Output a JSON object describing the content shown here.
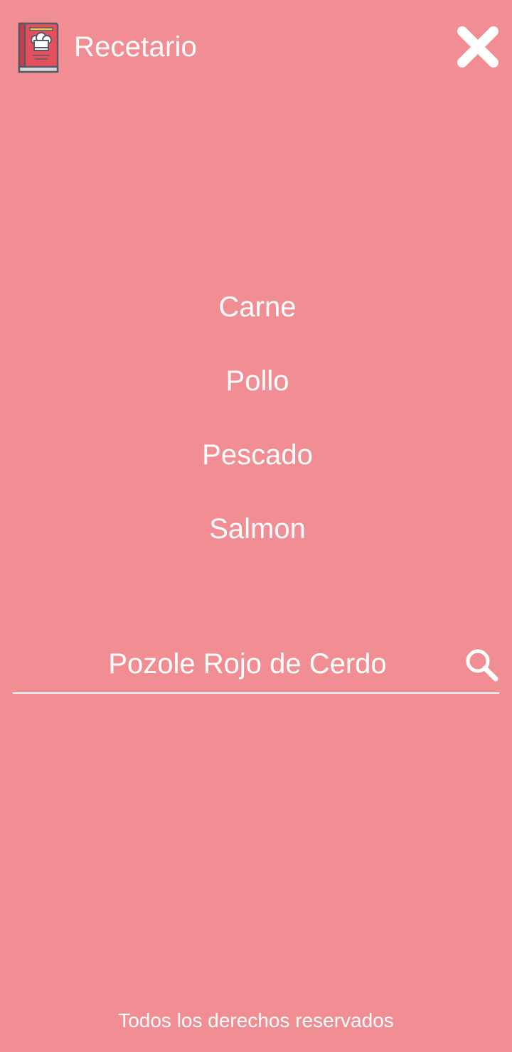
{
  "app": {
    "title": "Recetario",
    "logo_icon": "cookbook-chef-hat-icon",
    "close_icon": "close-icon"
  },
  "menu": {
    "items": [
      {
        "label": "Carne"
      },
      {
        "label": "Pollo"
      },
      {
        "label": "Pescado"
      },
      {
        "label": "Salmon"
      }
    ]
  },
  "search": {
    "placeholder": "Pozole Rojo de Cerdo",
    "value": "",
    "icon": "search-icon"
  },
  "footer": {
    "text": "Todos los derechos reservados"
  },
  "colors": {
    "background": "#f08e94",
    "text": "#ffffff",
    "book_cover": "#e84f5c"
  }
}
